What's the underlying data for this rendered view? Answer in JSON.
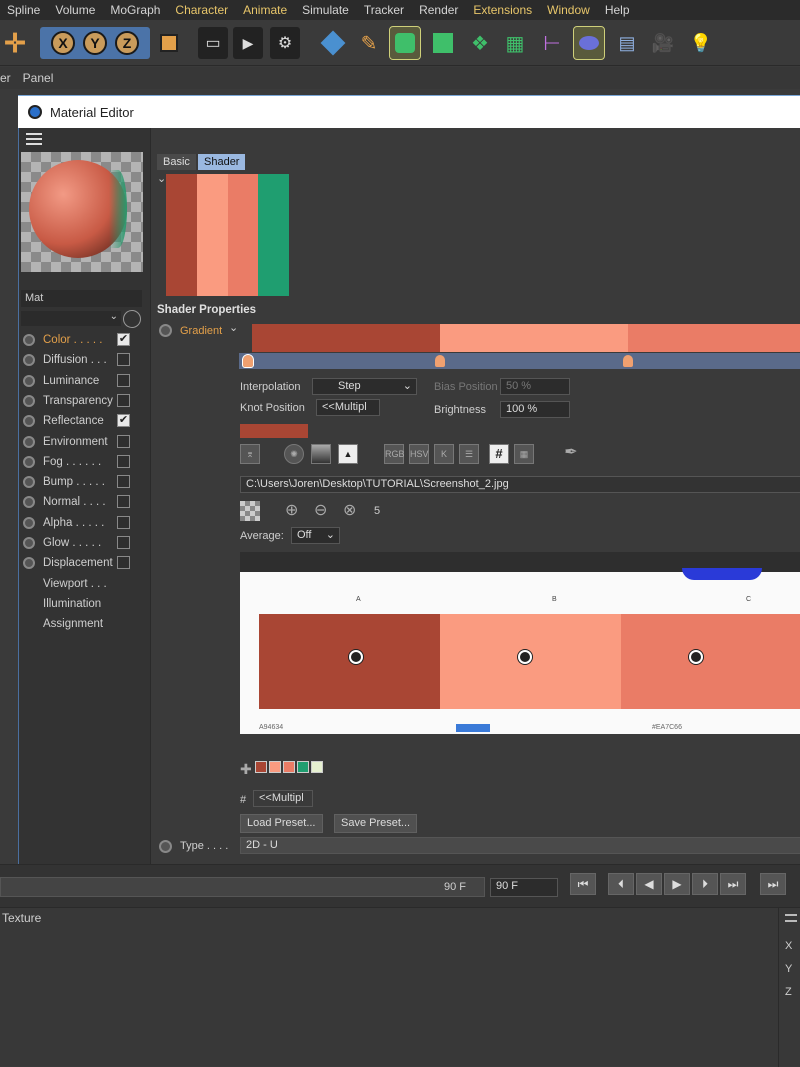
{
  "menubar": {
    "items": [
      "Spline",
      "Volume",
      "MoGraph",
      "Character",
      "Animate",
      "Simulate",
      "Tracker",
      "Render",
      "Extensions",
      "Window",
      "Help"
    ],
    "highlighted": [
      "Character",
      "Animate",
      "Extensions",
      "Window"
    ]
  },
  "toolbar": {
    "axes": [
      "X",
      "Y",
      "Z"
    ]
  },
  "panelbar": {
    "items": [
      "er",
      "Panel"
    ]
  },
  "material_editor": {
    "title": "Material Editor",
    "material_name": "Mat",
    "channels": [
      {
        "label": "Color . . . . .",
        "checked": true,
        "active": true
      },
      {
        "label": "Diffusion . . .",
        "checked": false
      },
      {
        "label": "Luminance",
        "checked": false
      },
      {
        "label": "Transparency",
        "checked": false
      },
      {
        "label": "Reflectance",
        "checked": true
      },
      {
        "label": "Environment",
        "checked": false
      },
      {
        "label": "Fog . . . . . .",
        "checked": false
      },
      {
        "label": "Bump . . . . .",
        "checked": false
      },
      {
        "label": "Normal . . . .",
        "checked": false
      },
      {
        "label": "Alpha . . . . .",
        "checked": false
      },
      {
        "label": "Glow . . . . .",
        "checked": false
      },
      {
        "label": "Displacement",
        "checked": false
      },
      {
        "label": "Viewport . . ."
      },
      {
        "label": "Illumination"
      },
      {
        "label": "Assignment"
      }
    ],
    "tabs": [
      "Basic",
      "Shader"
    ],
    "swatch_colors": [
      "#a94634",
      "#fa9b80",
      "#ea7c66",
      "#1f9e70"
    ],
    "shader_properties": "Shader Properties",
    "gradient_label": "Gradient",
    "gradient_colors": [
      "#a94634",
      "#fa9b80",
      "#ea7c66"
    ],
    "interpolation_label": "Interpolation",
    "interpolation_value": "Step",
    "bias_label": "Bias Position",
    "bias_value": "50 %",
    "knot_label": "Knot Position",
    "knot_value": "<<Multipl",
    "brightness_label": "Brightness",
    "brightness_value": "100 %",
    "icon_labels": [
      "RGB",
      "HSV",
      "K",
      "#"
    ],
    "file_path": "C:\\Users\\Joren\\Desktop\\TUTORIAL\\Screenshot_2.jpg",
    "count": "5",
    "average_label": "Average:",
    "average_value": "Off",
    "image_labels": [
      "A",
      "B",
      "C"
    ],
    "image_footer": [
      "A94634",
      "",
      "#EA7C66"
    ],
    "palette": [
      "#a94634",
      "#fa9b80",
      "#ea7c66",
      "#1f9e70",
      "#e6f0d0"
    ],
    "hash_label": "#",
    "hash_value": "<<Multipl",
    "load_preset": "Load Preset...",
    "save_preset": "Save Preset...",
    "type_label": "Type . . . .",
    "type_value": "2D - U"
  },
  "timeline": {
    "frame_left": "90 F",
    "frame_right": "90 F"
  },
  "bottom": {
    "title": "Texture",
    "axes": [
      "X",
      "Y",
      "Z"
    ]
  }
}
